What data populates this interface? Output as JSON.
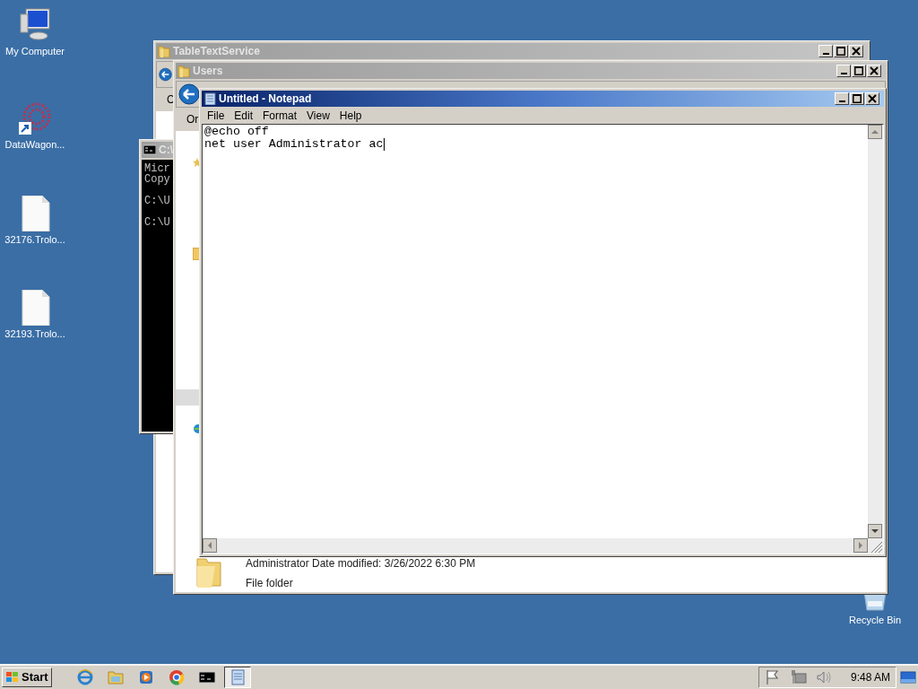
{
  "desktop_icons": [
    {
      "kind": "computer",
      "label": "My Computer"
    },
    {
      "kind": "shortcut",
      "label": "DataWagon..."
    },
    {
      "kind": "file",
      "label": "32176.Trolo..."
    },
    {
      "kind": "file",
      "label": "32193.Trolo..."
    },
    {
      "kind": "recycle",
      "label": "Recycle Bin"
    }
  ],
  "windows": [
    {
      "kind": "explorer",
      "title": "TableTextService",
      "active": false,
      "toolbar_text": "C"
    },
    {
      "kind": "console",
      "title": "C:\\",
      "active": false,
      "blocks": [
        [
          "Micr",
          "Copy"
        ],
        [
          "C:\\U"
        ],
        [
          "C:\\U"
        ]
      ]
    },
    {
      "kind": "explorer",
      "title": "Users",
      "active": false,
      "toolbar_text": "Or",
      "item": {
        "name": "Administrator",
        "detail": "Date modified: 3/26/2022 6:30 PM",
        "type": "File folder"
      }
    },
    {
      "kind": "notepad",
      "title": "Untitled - Notepad",
      "active": true,
      "menu": [
        "File",
        "Edit",
        "Format",
        "View",
        "Help"
      ],
      "text": [
        "@echo off",
        "net user Administrator ac"
      ]
    }
  ],
  "taskbar": {
    "start": "Start",
    "buttons": [
      {
        "kind": "ie",
        "selected": false
      },
      {
        "kind": "folder",
        "selected": false
      },
      {
        "kind": "media",
        "selected": false
      },
      {
        "kind": "chrome",
        "selected": false
      },
      {
        "kind": "console",
        "selected": false
      },
      {
        "kind": "notepad",
        "selected": true
      }
    ],
    "tray_icons": [
      {
        "kind": "flag"
      },
      {
        "kind": "network"
      },
      {
        "kind": "speaker"
      }
    ],
    "clock": "9:48 AM"
  }
}
